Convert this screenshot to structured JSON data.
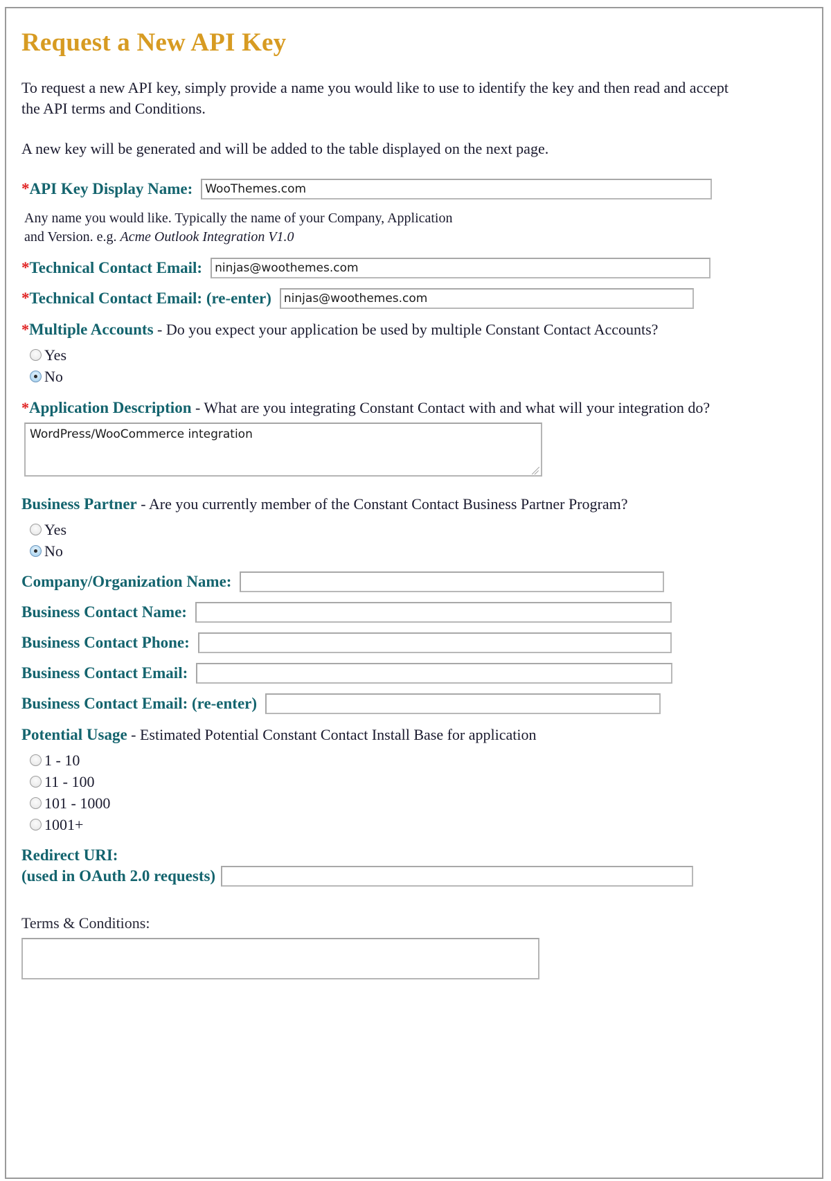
{
  "page": {
    "title": "Request a New API Key",
    "intro_paragraph_1": "To request a new API key, simply provide a name you would like to use to identify the key and then read and accept the API terms and Conditions.",
    "intro_paragraph_2": "A new key will be generated and will be added to the table displayed on the next page.",
    "title_color": "#d79b22",
    "label_color": "#14646e",
    "required_marker_color": "#e02020"
  },
  "fields": {
    "api_key_display_name": {
      "required_marker": "*",
      "label": "API Key Display Name:",
      "value": "WooThemes.com",
      "placeholder": "",
      "hint_line_1": "Any name you would like. Typically the name of your Company, Application",
      "hint_line_2_prefix": "and Version. e.g. ",
      "hint_line_2_italic": "Acme Outlook Integration V1.0"
    },
    "technical_contact_email": {
      "required_marker": "*",
      "label": "Technical Contact Email:",
      "value": "ninjas@woothemes.com",
      "placeholder": ""
    },
    "technical_contact_email_reenter": {
      "required_marker": "*",
      "label": "Technical Contact Email: (re-enter)",
      "value": "ninjas@woothemes.com",
      "placeholder": ""
    },
    "multiple_accounts": {
      "required_marker": "*",
      "label": "Multiple Accounts",
      "question": " - Do you expect your application be used by multiple Constant Contact Accounts?",
      "options": [
        {
          "label": "Yes",
          "checked": false
        },
        {
          "label": "No",
          "checked": true
        }
      ],
      "selected": "No"
    },
    "application_description": {
      "required_marker": "*",
      "label": "Application Description",
      "question": " - What are you integrating Constant Contact with and what will your integration do?",
      "value": "WordPress/WooCommerce integration",
      "placeholder": ""
    },
    "business_partner": {
      "required_marker": "",
      "label": "Business Partner",
      "question": " - Are you currently member of the Constant Contact Business Partner Program?",
      "options": [
        {
          "label": "Yes",
          "checked": false
        },
        {
          "label": "No",
          "checked": true
        }
      ],
      "selected": "No"
    },
    "company_organization_name": {
      "required_marker": "",
      "label": "Company/Organization Name:",
      "value": "",
      "placeholder": ""
    },
    "business_contact_name": {
      "required_marker": "",
      "label": "Business Contact Name:",
      "value": "",
      "placeholder": ""
    },
    "business_contact_phone": {
      "required_marker": "",
      "label": "Business Contact Phone:",
      "value": "",
      "placeholder": ""
    },
    "business_contact_email": {
      "required_marker": "",
      "label": "Business Contact Email:",
      "value": "",
      "placeholder": ""
    },
    "business_contact_email_reenter": {
      "required_marker": "",
      "label": "Business Contact Email: (re-enter)",
      "value": "",
      "placeholder": ""
    },
    "potential_usage": {
      "required_marker": "",
      "label": "Potential Usage",
      "question": " - Estimated Potential Constant Contact Install Base for application",
      "options": [
        {
          "label": "1 - 10",
          "checked": false
        },
        {
          "label": "11 - 100",
          "checked": false
        },
        {
          "label": "101 - 1000",
          "checked": false
        },
        {
          "label": "1001+",
          "checked": false
        }
      ],
      "selected": ""
    },
    "redirect_uri": {
      "required_marker": "",
      "label_line_1": "Redirect URI:",
      "label_line_2": "(used in OAuth 2.0 requests)",
      "value": "",
      "placeholder": ""
    },
    "terms_and_conditions": {
      "label": "Terms & Conditions:",
      "value": ""
    }
  }
}
